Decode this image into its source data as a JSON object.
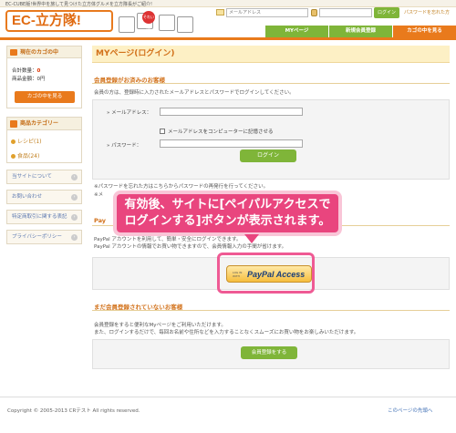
{
  "header": {
    "tagline": "EC-CUBE版!世界中を旅して見つけた立方体グルメを立方隊長がご紹介!",
    "logo_text": "EC-立方隊!",
    "mascot_badge": "それいけ!",
    "mail_placeholder": "メールアドレス",
    "login_button": "ログイン",
    "forgot_link": "パスワードを忘れた方"
  },
  "nav": {
    "mypage": "MYページ",
    "register": "新規会員登録",
    "cart": "カゴの中を見る"
  },
  "sidebar": {
    "cart_title": "現在のカゴの中",
    "cart_qty_label": "合計数量：",
    "cart_qty": "0",
    "cart_amount_label": "商品金額：",
    "cart_amount": "0円",
    "cart_button": "カゴの中を見る",
    "category_title": "商品カテゴリー",
    "categories": [
      "レシピ(1)",
      "食品(24)"
    ],
    "links": [
      "当サイトについて",
      "お問い合わせ",
      "特定商取引に関する表記",
      "プライバシーポリシー"
    ]
  },
  "main": {
    "page_title": "MYページ(ログイン)",
    "member_section_title": "会員登録がお済みのお客様",
    "member_intro": "会員の方は、登録時に入力されたメールアドレスとパスワードでログインしてください。",
    "email_label": "» メールアドレス：",
    "remember_text": "メールアドレスをコンピューターに記憶させる",
    "password_label": "» パスワード：",
    "login_button": "ログイン",
    "forgot_text_1": "※パスワードを忘れた方はこちらからパスワードの再発行を行ってください。",
    "forgot_text_2": "※メ",
    "paypal_section_title": "Pay",
    "paypal_text_1": "PayPal アカウントを利用して、簡単・安全にログインできます。",
    "paypal_text_2": "PayPal アカウントの情報でお買い物できますので、会員情報入力の手間が省けます。",
    "paypal_button_small": "LOG IN WITH",
    "paypal_button_text": "PayPal Access",
    "nonmember_title": "まだ会員登録されていないお客様",
    "nonmember_text_1": "会員登録をすると便利なMyページをご利用いただけます。",
    "nonmember_text_2": "また、ログインするだけで、毎回お名前や住所などを入力することなくスムーズにお買い物をお楽しみいただけます。",
    "register_button": "会員登録をする"
  },
  "callout": {
    "line1": "有効後、サイトに[ペイパルアクセスで",
    "line2": "ログインする]ボタンが表示されます。"
  },
  "footer": {
    "copyright": "Copyright © 2005-2013 CRテスト All rights reserved.",
    "page_top": "このページの先頭へ"
  },
  "colors": {
    "accent_orange": "#e97a1c",
    "accent_green": "#7fb539",
    "callout_pink": "#e9457e"
  }
}
